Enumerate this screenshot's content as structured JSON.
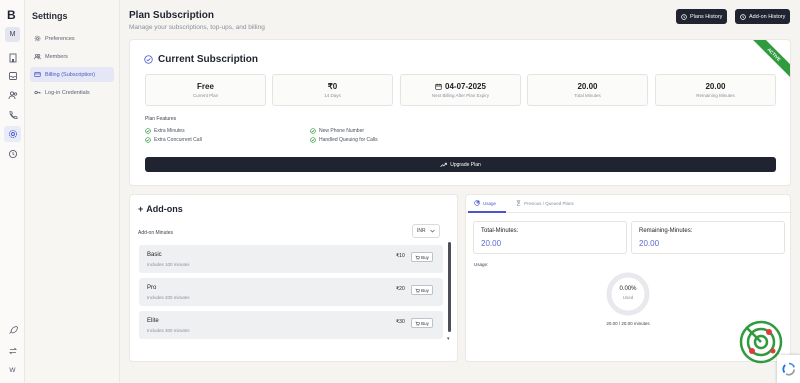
{
  "app": {
    "logo": "B",
    "workspace_avatar": "M",
    "user_avatar": "W"
  },
  "sidebar": {
    "title": "Settings",
    "items": [
      {
        "label": "Preferences",
        "icon": "gear-icon",
        "active": false
      },
      {
        "label": "Members",
        "icon": "users-icon",
        "active": false
      },
      {
        "label": "Billing (Subscription)",
        "icon": "card-icon",
        "active": true
      },
      {
        "label": "Log-in Credentials",
        "icon": "key-icon",
        "active": false
      }
    ]
  },
  "header": {
    "title": "Plan Subscription",
    "subtitle": "Manage your subscriptions, top-ups, and billing",
    "plans_history_label": "Plans History",
    "addon_history_label": "Add-on History"
  },
  "subscription": {
    "title": "Current Subscription",
    "badge": "ACTIVE",
    "stats": [
      {
        "value": "Free",
        "label": "Current Plan"
      },
      {
        "value": "₹0",
        "label": "14 Days"
      },
      {
        "value": "04-07-2025",
        "label": "Next Billing After Plan Expiry"
      },
      {
        "value": "20.00",
        "label": "Total Minutes"
      },
      {
        "value": "20.00",
        "label": "Remaining Minutes"
      }
    ],
    "features_title": "Plan Features",
    "features": [
      "Extra Minutes",
      "New Phone Number",
      "Extra Concurrent Call",
      "Handled Queuing for Calls"
    ],
    "upgrade_label": "Upgrade Plan"
  },
  "addons": {
    "title": "Add-ons",
    "section_label": "Add-on Minutes",
    "currency": "INR",
    "items": [
      {
        "name": "Basic",
        "desc": "Includes 100 minutes",
        "price": "₹10",
        "buy": "Buy"
      },
      {
        "name": "Pro",
        "desc": "Includes 200 minutes",
        "price": "₹20",
        "buy": "Buy"
      },
      {
        "name": "Elite",
        "desc": "Includes 300 minutes",
        "price": "₹30",
        "buy": "Buy"
      }
    ]
  },
  "usage": {
    "tabs": [
      {
        "label": "Usage",
        "active": true
      },
      {
        "label": "Previous / Queued Plans",
        "active": false
      }
    ],
    "total_label": "Total-Minutes:",
    "total_value": "20.00",
    "remaining_label": "Remaining-Minutes:",
    "remaining_value": "20.00",
    "section_label": "Usage:",
    "percent": "0.00%",
    "percent_label": "Used",
    "used_fraction": 0.0,
    "caption": "20.00 / 20.00 minutes"
  },
  "colors": {
    "dark": "#1f2430",
    "accent": "#4b57c8",
    "active_badge": "#2f9a3e",
    "success": "#2f9a3e"
  }
}
